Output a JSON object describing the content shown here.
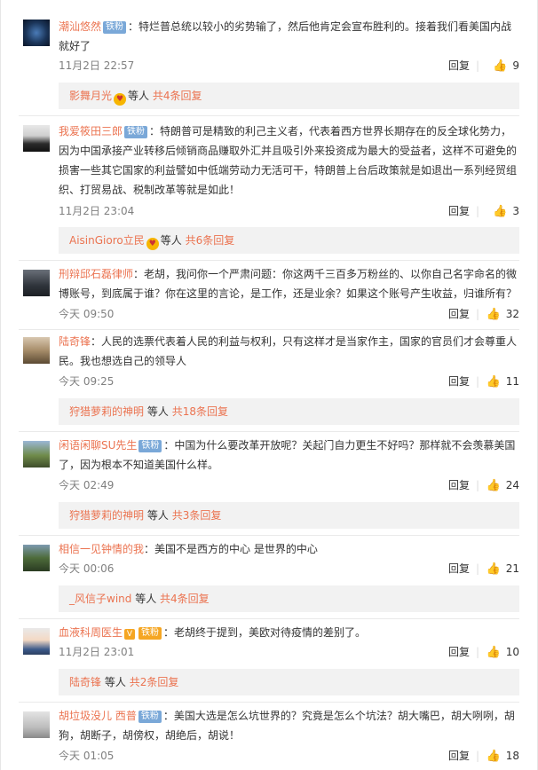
{
  "icons": {
    "like": "thumbs-up-icon",
    "badge": "fan-badge-icon",
    "heart": "heart-badge-icon",
    "vip": "vip-icon"
  },
  "ui": {
    "reply": "回复",
    "etc": "等人"
  },
  "comments": [
    {
      "user": "潮汕悠然",
      "badge": "铁粉",
      "sep": "：",
      "lines": [
        "特烂普总统以较小的劣势输了，然后他肯定会宣布胜利的。接着我们看美国内战",
        "就好了"
      ],
      "time": "11月2日 22:57",
      "likes": "9",
      "sub": {
        "name": "影舞月光",
        "count": "共4条回复"
      }
    },
    {
      "user": "我爱筱田三郎",
      "badge": "铁粉",
      "sep": "：",
      "lines": [
        "特朗普可是精致的利己主义者，代表着西方世界长期存在的反全球化势力，",
        "因为中国承接产业转移后倾销商品赚取外汇并且吸引外来投资成为最大的受益者，这样不可避免的",
        "损害一些其它国家的利益譬如中低端劳动力无活可干，特朗普上台后政策就是如退出一系列经贸组",
        "织、打贸易战、税制改革等就是如此！"
      ],
      "time": "11月2日 23:04",
      "likes": "3",
      "sub": {
        "name": "AisinGioro立民",
        "count": "共6条回复"
      }
    },
    {
      "user": "刑辩邱石磊律师",
      "sep": "：",
      "lines": [
        "老胡，我问你一个严肃问题：你这两千三百多万粉丝的、以你自己名字命名的微",
        "博账号，到底属于谁？你在这里的言论，是工作，还是业余？如果这个账号产生收益，归谁所有？"
      ],
      "time": "今天 09:50",
      "likes": "32"
    },
    {
      "user": "陆奇锋",
      "sep": "：",
      "lines": [
        "人民的选票代表着人民的利益与权利，只有这样才是当家作主，国家的官员们才会尊重人",
        "民。我也想选自己的领导人"
      ],
      "time": "今天 09:25",
      "likes": "11",
      "sub": {
        "name": "狩猎萝莉的神明",
        "count": "共18条回复"
      }
    },
    {
      "user": "闲语闲聊SU先生",
      "badge": "铁粉",
      "sep": "：",
      "lines": [
        "中国为什么要改革开放呢？关起门自力更生不好吗？那样就不会羡慕美国",
        "了，因为根本不知道美国什么样。"
      ],
      "time": "今天 02:49",
      "likes": "24",
      "sub": {
        "name": "狩猎萝莉的神明",
        "count": "共3条回复"
      }
    },
    {
      "user": "相信一见钟情的我",
      "sep": "：",
      "lines": [
        "美国不是西方的中心 是世界的中心"
      ],
      "time": "今天 00:06",
      "likes": "21",
      "sub": {
        "name": "_风信子wind",
        "count": "共4条回复"
      }
    },
    {
      "user": "血液科周医生",
      "vip": "V",
      "badge": "铁粉",
      "sep": "：",
      "lines": [
        "老胡终于提到，美欧对待疫情的差别了。"
      ],
      "time": "11月2日 23:01",
      "likes": "10",
      "sub": {
        "name": "陆奇锋",
        "count": "共2条回复"
      }
    },
    {
      "user": "胡垃圾没儿 西普",
      "badge": "铁粉",
      "sep": "：",
      "lines": [
        "美国大选是怎么坑世界的？究竟是怎么个坑法？胡大嘴巴，胡大咧咧，胡",
        "狗，胡断子，胡傍权，胡绝后，胡说！"
      ],
      "time": "今天 01:05",
      "likes": "18"
    }
  ]
}
